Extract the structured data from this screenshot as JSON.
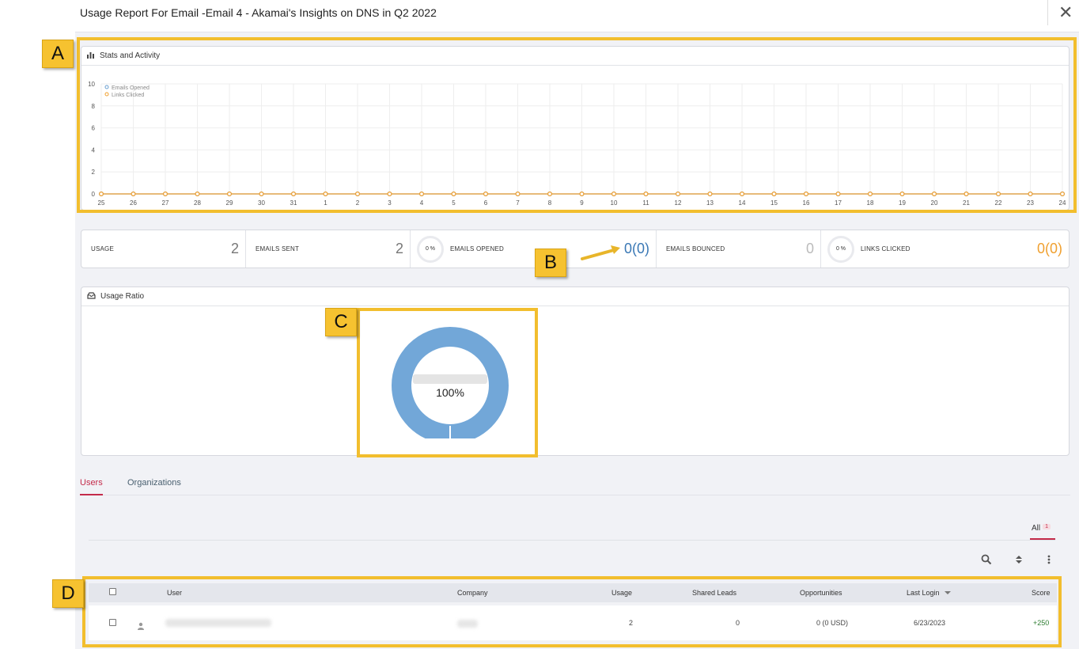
{
  "header": {
    "title": "Usage Report For Email -Email 4 - Akamai's Insights on DNS in Q2 2022",
    "close_label": "✕"
  },
  "stats_panel": {
    "title": "Stats and Activity"
  },
  "chart_data": {
    "type": "line",
    "x": [
      "25",
      "26",
      "27",
      "28",
      "29",
      "30",
      "31",
      "1",
      "2",
      "3",
      "4",
      "5",
      "6",
      "7",
      "8",
      "9",
      "10",
      "11",
      "12",
      "13",
      "14",
      "15",
      "16",
      "17",
      "18",
      "19",
      "20",
      "21",
      "22",
      "23",
      "24"
    ],
    "series": [
      {
        "name": "Emails Opened",
        "color": "#6a9fd0",
        "values": [
          0,
          0,
          0,
          0,
          0,
          0,
          0,
          0,
          0,
          0,
          0,
          0,
          0,
          0,
          0,
          0,
          0,
          0,
          0,
          0,
          0,
          0,
          0,
          0,
          0,
          0,
          0,
          0,
          0,
          0,
          0
        ]
      },
      {
        "name": "Links Clicked",
        "color": "#f0a030",
        "values": [
          0,
          0,
          0,
          0,
          0,
          0,
          0,
          0,
          0,
          0,
          0,
          0,
          0,
          0,
          0,
          0,
          0,
          0,
          0,
          0,
          0,
          0,
          0,
          0,
          0,
          0,
          0,
          0,
          0,
          0,
          0
        ]
      }
    ],
    "yticks": [
      "0",
      "2",
      "4",
      "6",
      "8",
      "10"
    ],
    "ylim": [
      0,
      10
    ],
    "legend": "top-left",
    "grid": true
  },
  "metrics": [
    {
      "label": "USAGE",
      "value": "2",
      "color": "#777777"
    },
    {
      "label": "EMAILS SENT",
      "value": "2",
      "color": "#777777"
    },
    {
      "label": "EMAILS OPENED",
      "ring": "0 %",
      "value": "0(0)",
      "color": "#3a78b5"
    },
    {
      "label": "EMAILS BOUNCED",
      "value": "0",
      "color": "#bbbbbb"
    },
    {
      "label": "LINKS CLICKED",
      "ring": "0 %",
      "value": "0(0)",
      "color": "#f0a030"
    }
  ],
  "ratio_panel": {
    "title": "Usage Ratio",
    "donut_label": "100%",
    "donut_percent": 100,
    "donut_color": "#72a7d8"
  },
  "annotations": {
    "a": "A",
    "b": "B",
    "c": "C",
    "d": "D"
  },
  "tabs": [
    {
      "label": "Users",
      "active": true
    },
    {
      "label": "Organizations",
      "active": false
    }
  ],
  "filter": {
    "all_label": "All",
    "all_count": "1"
  },
  "table": {
    "headers": {
      "user": "User",
      "company": "Company",
      "usage": "Usage",
      "shared_leads": "Shared Leads",
      "opportunities": "Opportunities",
      "last_login": "Last Login",
      "score": "Score"
    },
    "rows": [
      {
        "usage": "2",
        "shared_leads": "0",
        "opportunities": "0 (0 USD)",
        "last_login": "6/23/2023",
        "score": "+250"
      }
    ]
  }
}
